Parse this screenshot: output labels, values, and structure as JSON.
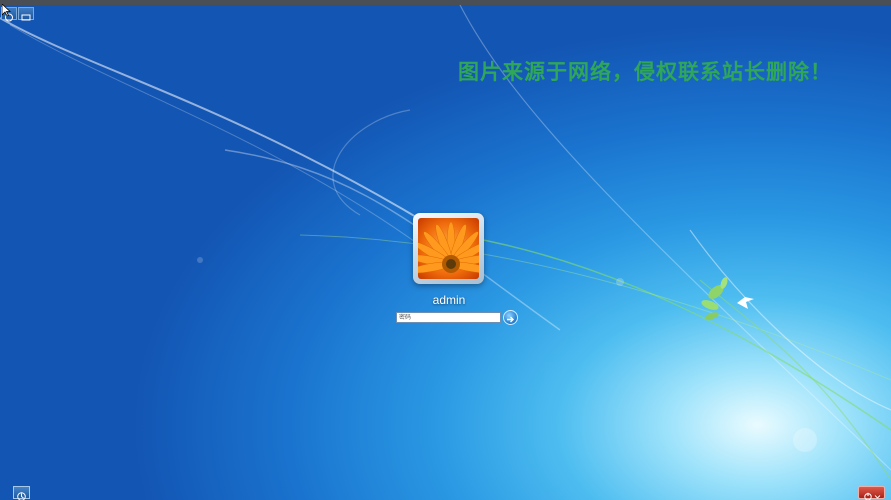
{
  "watermark": {
    "text": "图片来源于网络，侵权联系站长删除！",
    "color": "#2fa65a"
  },
  "login": {
    "username": "admin",
    "password_placeholder": "密码",
    "avatar_image": "orange-gerbera-flower"
  },
  "icons": {
    "top_left": [
      "ease-of-access-icon",
      "keyboard-icon"
    ],
    "bottom_left": "ease-of-access-icon",
    "bottom_right": [
      "power-icon",
      "chevron-down-icon"
    ],
    "submit": "arrow-right-icon",
    "cursor": "mouse-pointer-icon"
  },
  "colors": {
    "background": "#1a74cf",
    "power_button": "#c8392c",
    "submit_button": "#2b87d6"
  }
}
